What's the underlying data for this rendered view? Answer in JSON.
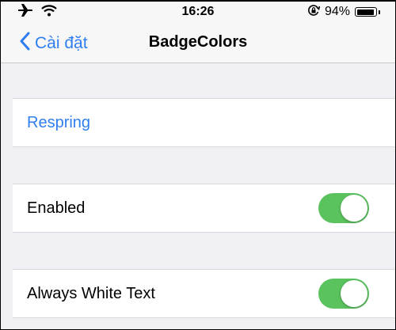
{
  "status_bar": {
    "time": "16:26",
    "battery_percent": "94%",
    "battery_level": 0.94,
    "icons": [
      "airplane-icon",
      "wifi-icon",
      "orientation-lock-icon",
      "battery-icon"
    ]
  },
  "nav": {
    "back_label": "Cài đặt",
    "title": "BadgeColors"
  },
  "rows": {
    "respring": {
      "label": "Respring"
    },
    "enabled": {
      "label": "Enabled",
      "on": true
    },
    "always_white": {
      "label": "Always White Text",
      "on": true
    }
  },
  "colors": {
    "accent": "#2f7ef0",
    "toggle_on": "#5ac35e",
    "background": "#efeff4"
  }
}
